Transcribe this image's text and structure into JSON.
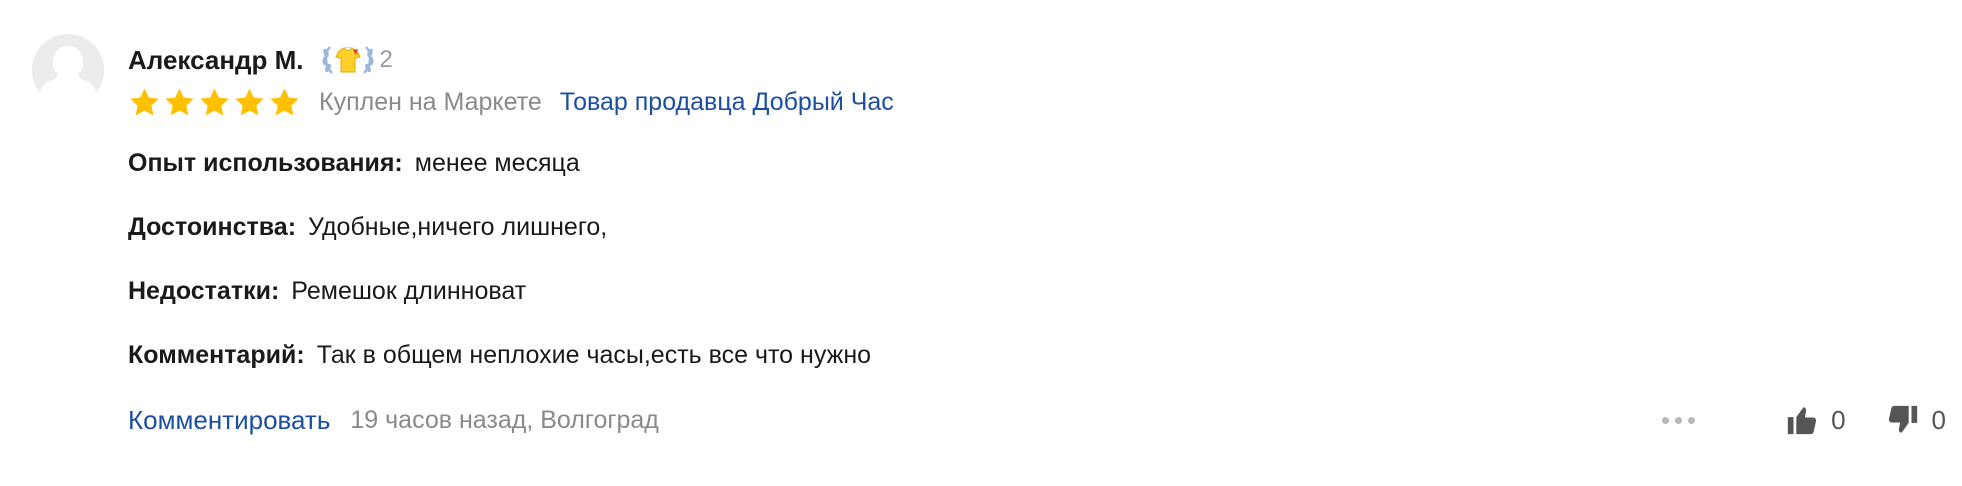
{
  "review": {
    "author": "Александр М.",
    "badge": {
      "icon": "laurel-tshirt-badge-icon",
      "level": "2"
    },
    "rating": 5,
    "rating_max": 5,
    "bought_label": "Куплен на Маркете",
    "seller_link": "Товар продавца Добрый Час",
    "sections": [
      {
        "label": "Опыт использования:",
        "value": "менее месяца"
      },
      {
        "label": "Достоинства:",
        "value": "Удобные,ничего лишнего,"
      },
      {
        "label": "Недостатки:",
        "value": "Ремешок длинноват"
      },
      {
        "label": "Комментарий:",
        "value": "Так в общем неплохие часы,есть все что нужно"
      }
    ],
    "footer": {
      "comment_link": "Комментировать",
      "date_location": "19 часов назад, Волгоград"
    },
    "votes": {
      "likes": "0",
      "dislikes": "0"
    }
  },
  "colors": {
    "link": "#1c4fa0",
    "star": "#ffc000",
    "muted": "#8a8a8a",
    "text": "#1a1a1a"
  }
}
